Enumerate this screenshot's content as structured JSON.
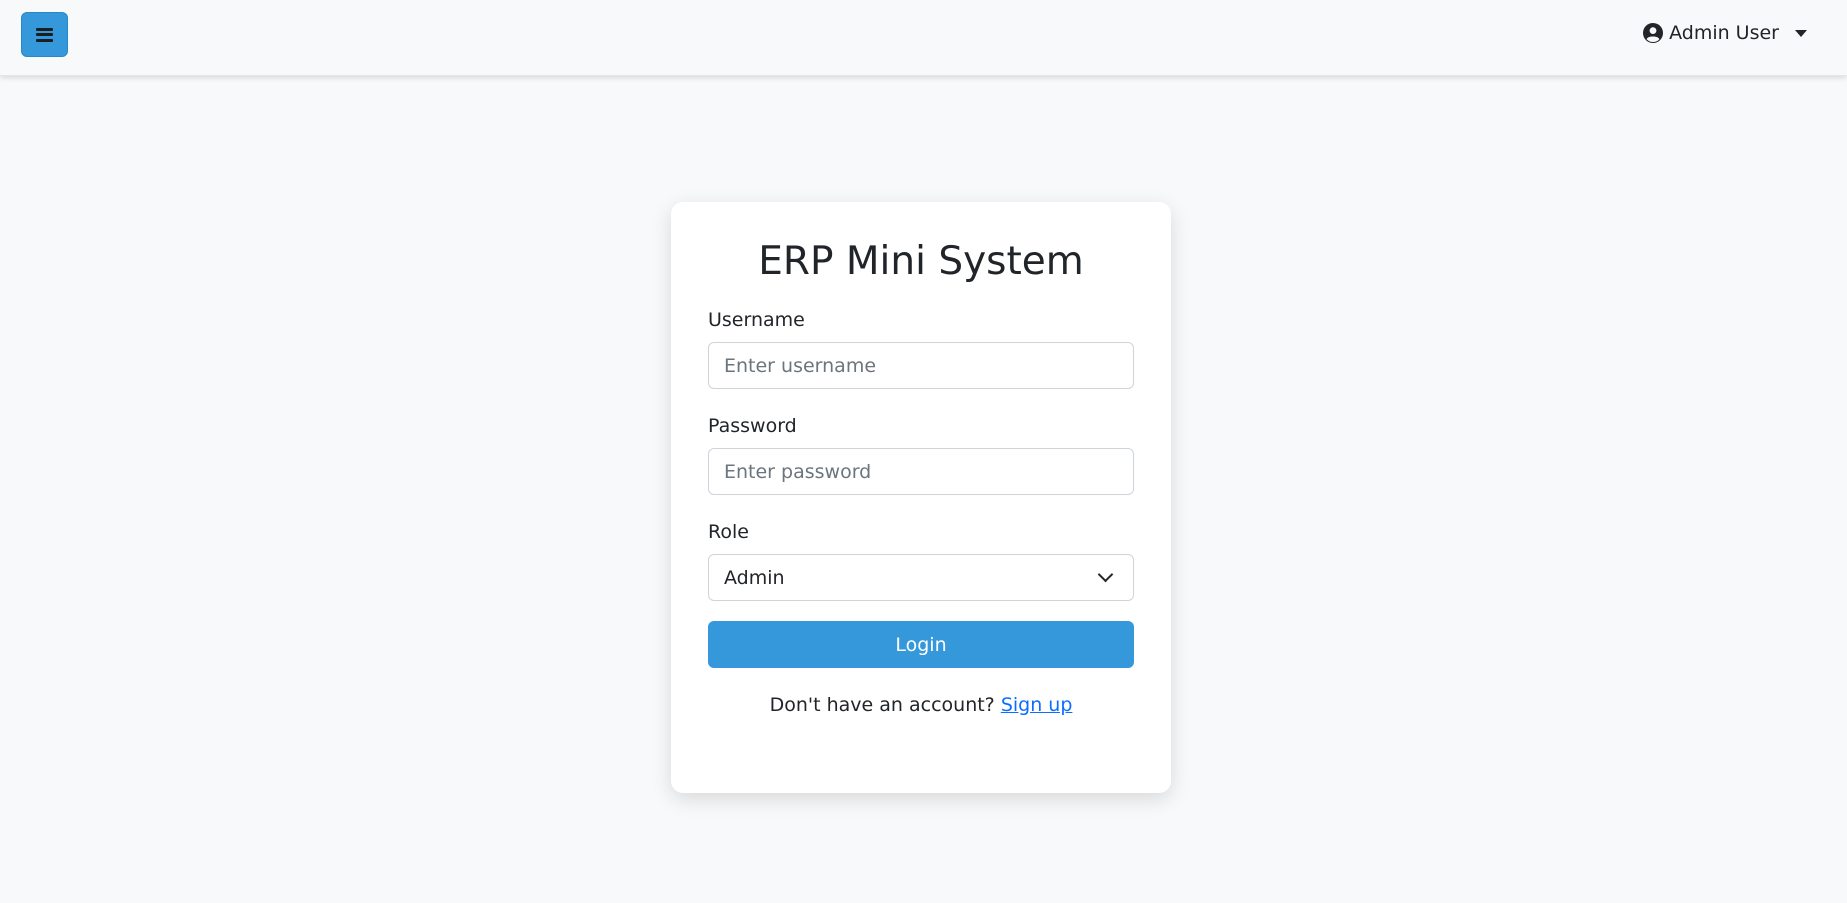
{
  "navbar": {
    "menu_icon": "hamburger-icon",
    "user": {
      "icon": "user-circle-icon",
      "name": "Admin User",
      "caret_icon": "caret-down-icon"
    }
  },
  "login": {
    "title": "ERP Mini System",
    "username": {
      "label": "Username",
      "placeholder": "Enter username",
      "value": ""
    },
    "password": {
      "label": "Password",
      "placeholder": "Enter password",
      "value": ""
    },
    "role": {
      "label": "Role",
      "selected": "Admin",
      "chevron_icon": "chevron-down-icon"
    },
    "submit_label": "Login",
    "signup_prompt": "Don't have an account?",
    "signup_link": "Sign up"
  },
  "colors": {
    "accent": "#3498db",
    "page_bg": "#f8f9fa",
    "link": "#0d6efd"
  }
}
